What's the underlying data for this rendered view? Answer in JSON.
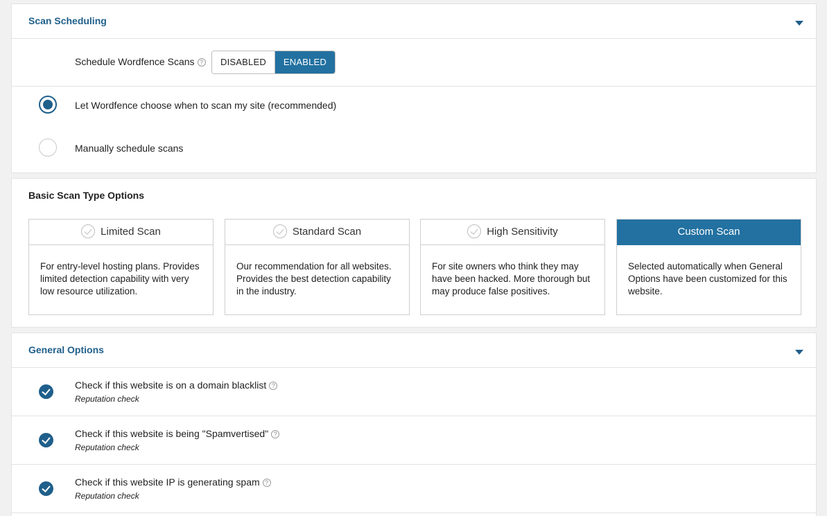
{
  "scan_scheduling": {
    "title": "Scan Scheduling",
    "schedule_label": "Schedule Wordfence Scans",
    "toggle_disabled": "DISABLED",
    "toggle_enabled": "ENABLED",
    "toggle_selected": "ENABLED",
    "options": [
      {
        "label": "Let Wordfence choose when to scan my site (recommended)",
        "checked": true
      },
      {
        "label": "Manually schedule scans",
        "checked": false
      }
    ]
  },
  "basic_scan_type": {
    "title": "Basic Scan Type Options",
    "cards": [
      {
        "title": "Limited Scan",
        "description": "For entry-level hosting plans. Provides limited detection capability with very low resource utilization.",
        "selected": false
      },
      {
        "title": "Standard Scan",
        "description": "Our recommendation for all websites. Provides the best detection capability in the industry.",
        "selected": false
      },
      {
        "title": "High Sensitivity",
        "description": "For site owners who think they may have been hacked. More thorough but may produce false positives.",
        "selected": false
      },
      {
        "title": "Custom Scan",
        "description": "Selected automatically when General Options have been customized for this website.",
        "selected": true
      }
    ]
  },
  "general_options": {
    "title": "General Options",
    "options": [
      {
        "label": "Check if this website is on a domain blacklist",
        "sub": "Reputation check",
        "checked": true
      },
      {
        "label": "Check if this website is being \"Spamvertised\"",
        "sub": "Reputation check",
        "checked": true
      },
      {
        "label": "Check if this website IP is generating spam",
        "sub": "Reputation check",
        "checked": true
      }
    ]
  },
  "icons": {
    "help": "?",
    "accent": "#2271a1",
    "title_color": "#1f5f8b"
  }
}
